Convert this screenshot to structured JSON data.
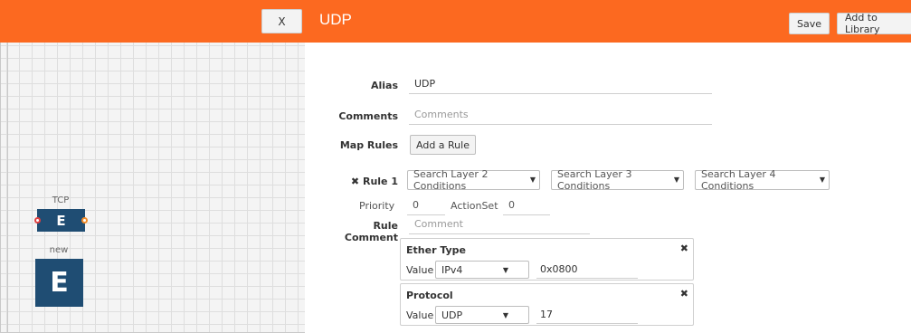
{
  "canvas": {
    "close_label": "X",
    "nodes": [
      {
        "label": "TCP",
        "glyph": "E"
      },
      {
        "label": "new",
        "glyph": "E"
      }
    ]
  },
  "header": {
    "title": "UDP",
    "save_label": "Save",
    "library_label": "Add to Library",
    "accent_color": "#fc6920"
  },
  "form": {
    "alias_label": "Alias",
    "alias_value": "UDP",
    "comments_label": "Comments",
    "comments_placeholder": "Comments",
    "map_rules_label": "Map Rules",
    "add_rule_label": "Add a Rule",
    "rule": {
      "remove_glyph": "✖",
      "label": "Rule 1",
      "layer2_placeholder": "Search Layer 2 Conditions",
      "layer3_placeholder": "Search Layer 3 Conditions",
      "layer4_placeholder": "Search Layer 4 Conditions",
      "priority_label": "Priority",
      "priority_value": "0",
      "actionset_label": "ActionSet",
      "actionset_value": "0",
      "comment_label": "Rule Comment",
      "comment_placeholder": "Comment"
    },
    "conditions": [
      {
        "title": "Ether Type",
        "value_label": "Value",
        "selected": "IPv4",
        "input": "0x0800"
      },
      {
        "title": "Protocol",
        "value_label": "Value",
        "selected": "UDP",
        "input": "17"
      }
    ]
  }
}
